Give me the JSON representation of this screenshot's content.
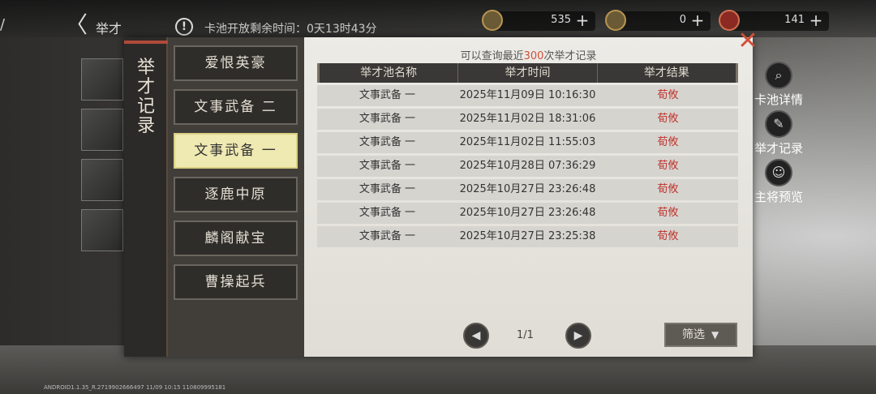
{
  "header": {
    "title": "举才",
    "alert_icon": "exclamation-icon",
    "pool_timer": "卡池开放剩余时间：0天13时43分"
  },
  "currencies": [
    {
      "icon": "coin-icon",
      "value": "535",
      "add": "+"
    },
    {
      "icon": "jade-icon",
      "value": "0",
      "add": "+"
    },
    {
      "icon": "token-icon",
      "value": "141",
      "add": "+"
    }
  ],
  "side_buttons": [
    {
      "label": "卡池详情",
      "icon": "magnifier-icon"
    },
    {
      "label": "举才记录",
      "icon": "brush-icon"
    },
    {
      "label": "主将预览",
      "icon": "face-icon"
    }
  ],
  "dialog": {
    "title": "举才记录",
    "pools": [
      {
        "label": "爱恨英豪",
        "active": false
      },
      {
        "label": "文事武备 二",
        "active": false
      },
      {
        "label": "文事武备 一",
        "active": true
      },
      {
        "label": "逐鹿中原",
        "active": false
      },
      {
        "label": "麟阁献宝",
        "active": false
      },
      {
        "label": "曹操起兵",
        "active": false
      }
    ],
    "query": {
      "prefix": "可以查询最近",
      "count": "300",
      "suffix": "次举才记录"
    },
    "table": {
      "headers": [
        "举才池名称",
        "举才时间",
        "举才结果"
      ],
      "rows": [
        [
          "文事武备 一",
          "2025年11月09日 10:16:30",
          "荀攸"
        ],
        [
          "文事武备 一",
          "2025年11月02日 18:31:06",
          "荀攸"
        ],
        [
          "文事武备 一",
          "2025年11月02日 11:55:03",
          "荀攸"
        ],
        [
          "文事武备 一",
          "2025年10月28日 07:36:29",
          "荀攸"
        ],
        [
          "文事武备 一",
          "2025年10月27日 23:26:48",
          "荀攸"
        ],
        [
          "文事武备 一",
          "2025年10月27日 23:26:48",
          "荀攸"
        ],
        [
          "文事武备 一",
          "2025年10月27日 23:25:38",
          "荀攸"
        ]
      ]
    },
    "pagination": {
      "page": "1/1"
    },
    "filter_label": "筛选"
  },
  "footer": {
    "build_info": "ANDROID1.1.35_R.2719902666497 11/09 10:15 110809995181"
  }
}
